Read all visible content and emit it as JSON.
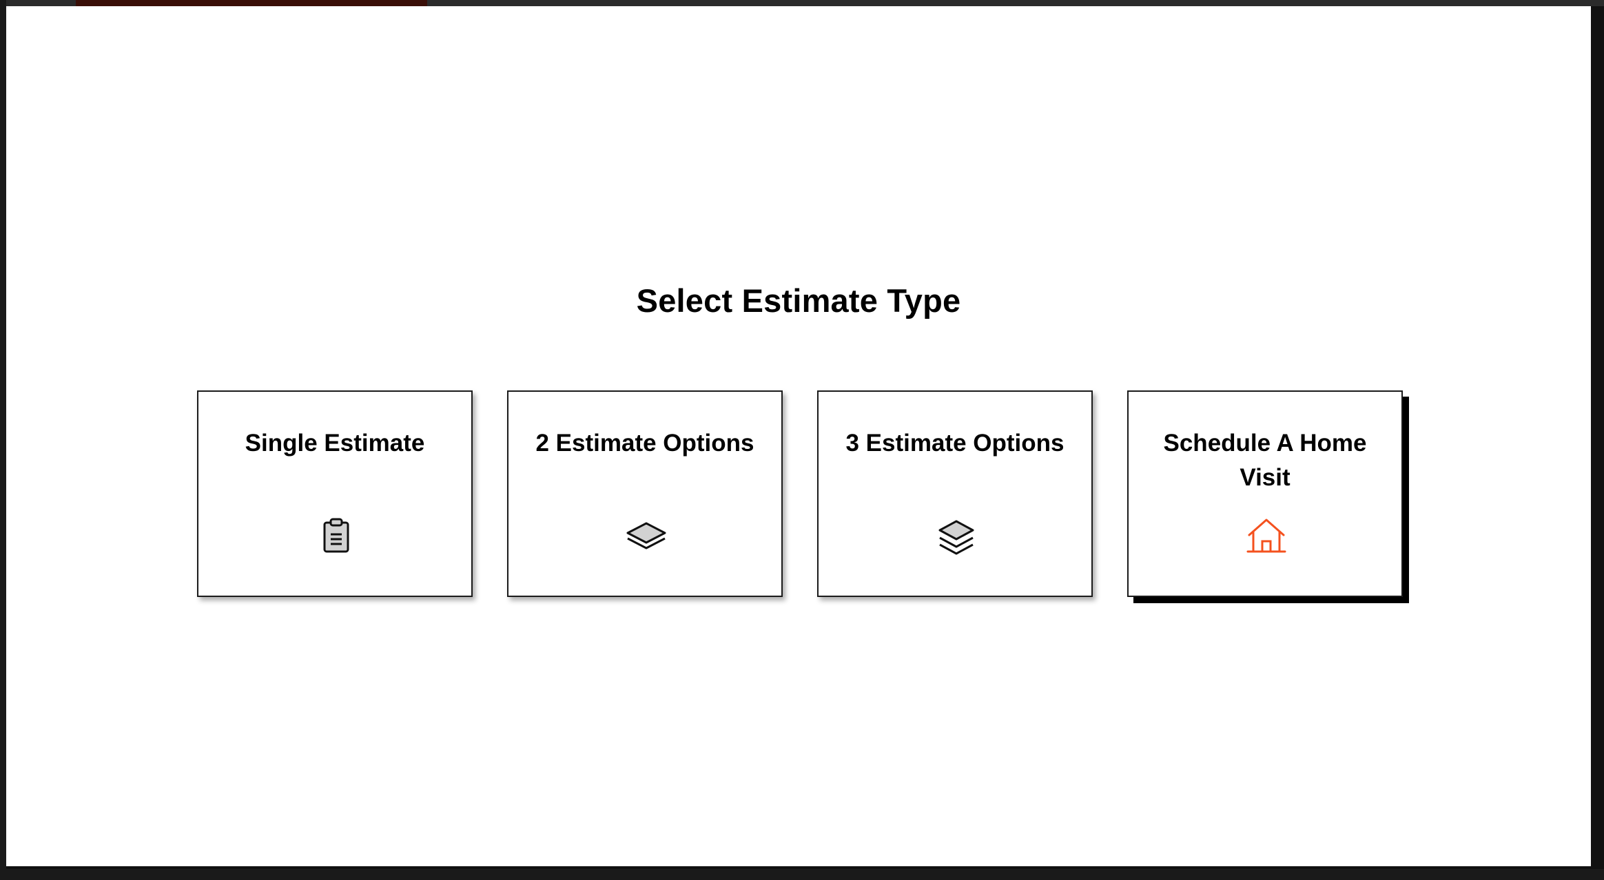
{
  "title": "Select Estimate Type",
  "options": [
    {
      "label": "Single Estimate",
      "icon": "clipboard-icon"
    },
    {
      "label": "2 Estimate Options",
      "icon": "layers-two-icon"
    },
    {
      "label": "3 Estimate Options",
      "icon": "layers-three-icon"
    },
    {
      "label": "Schedule A Home Visit",
      "icon": "home-icon",
      "selected": true
    }
  ],
  "colors": {
    "accent": "#f4511e",
    "icon_fill": "#d2d2d2",
    "icon_stroke": "#111111"
  }
}
